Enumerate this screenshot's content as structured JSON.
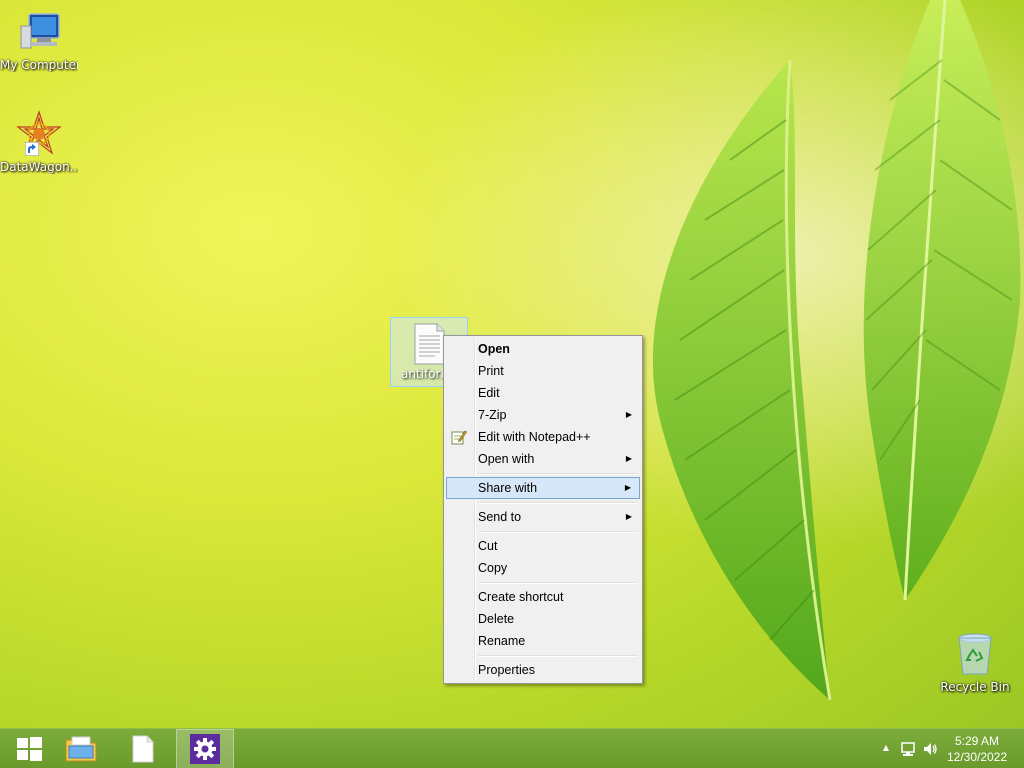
{
  "desktop": {
    "icons": [
      {
        "label": "My Computer"
      },
      {
        "label": "DataWagon..."
      },
      {
        "label": "Recycle Bin"
      }
    ],
    "selected_file": {
      "label": "antiforkis"
    }
  },
  "context_menu": {
    "items": [
      {
        "label": "Open"
      },
      {
        "label": "Print"
      },
      {
        "label": "Edit"
      },
      {
        "label": "7-Zip"
      },
      {
        "label": "Edit with Notepad++"
      },
      {
        "label": "Open with"
      },
      {
        "label": "Share with"
      },
      {
        "label": "Send to"
      },
      {
        "label": "Cut"
      },
      {
        "label": "Copy"
      },
      {
        "label": "Create shortcut"
      },
      {
        "label": "Delete"
      },
      {
        "label": "Rename"
      },
      {
        "label": "Properties"
      }
    ],
    "submenu_arrow": "▶",
    "highlighted": "Share with"
  },
  "taskbar": {
    "buttons": [
      "start-icon",
      "file-explorer-icon",
      "document-icon",
      "settings-icon"
    ],
    "tray": {
      "show_hidden_arrow": "▲"
    },
    "clock": {
      "time": "5:29 AM",
      "date": "12/30/2022"
    }
  },
  "colors": {
    "taskbar": "#6f9f30",
    "menu_highlight": "#d5e7f8",
    "menu_highlight_border": "#7da2ce",
    "settings_tile": "#5b2d9e"
  }
}
